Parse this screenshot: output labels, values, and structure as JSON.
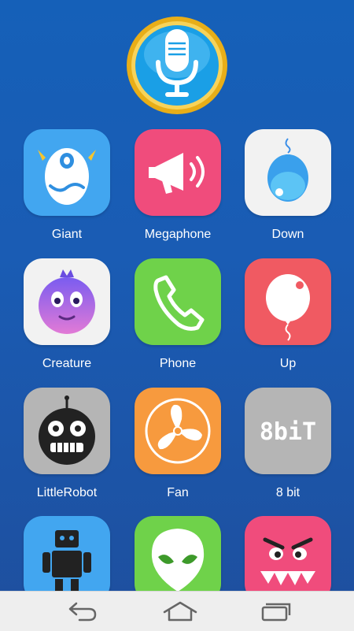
{
  "voice": {
    "icon": "microphone-icon",
    "ring_color": "#e9b01a",
    "face_color": "#1a9fe6"
  },
  "apps": [
    {
      "label": "Giant",
      "icon": "giant-monster-icon",
      "bg": "#42a6f0"
    },
    {
      "label": "Megaphone",
      "icon": "megaphone-icon",
      "bg": "#f04c7c"
    },
    {
      "label": "Down",
      "icon": "falling-balloon-icon",
      "bg": "#f2f2f2"
    },
    {
      "label": "Creature",
      "icon": "purple-creature-icon",
      "bg": "#f2f2f2"
    },
    {
      "label": "Phone",
      "icon": "phone-handset-icon",
      "bg": "#6fd24a"
    },
    {
      "label": "Up",
      "icon": "rising-balloon-icon",
      "bg": "#f05a62"
    },
    {
      "label": "LittleRobot",
      "icon": "robot-face-icon",
      "bg": "#b5b5b5"
    },
    {
      "label": "Fan",
      "icon": "fan-icon",
      "bg": "#f79a3e"
    },
    {
      "label": "8 bit",
      "icon": "8bit-text-icon",
      "bg": "#b5b5b5",
      "icon_text": "8biT"
    },
    {
      "label": "",
      "icon": "robot-body-icon",
      "bg": "#42a6f0"
    },
    {
      "label": "",
      "icon": "alien-icon",
      "bg": "#6fd24a"
    },
    {
      "label": "",
      "icon": "angry-monster-icon",
      "bg": "#f04c7c"
    }
  ],
  "nav": {
    "back": "back-icon",
    "home": "home-icon",
    "recents": "recents-icon"
  }
}
